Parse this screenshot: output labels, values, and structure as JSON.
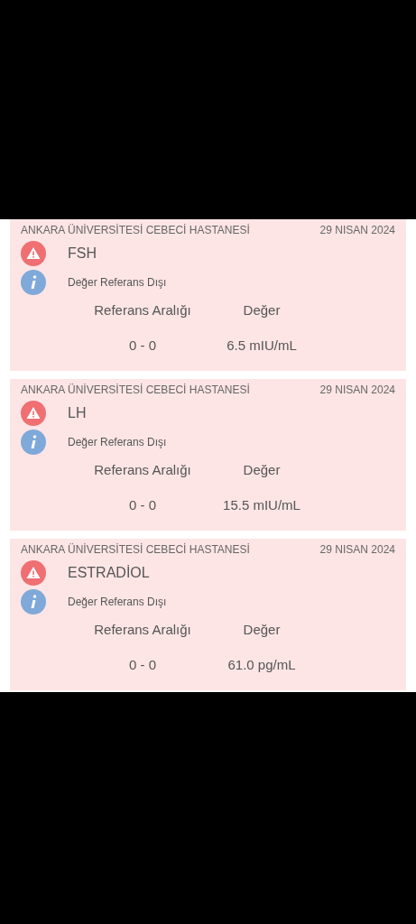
{
  "results": [
    {
      "hospital": "ANKARA ÜNİVERSİTESİ CEBECİ HASTANESİ",
      "date": "29 NISAN 2024",
      "test": "FSH",
      "status": "Değer Referans Dışı",
      "range_label": "Referans Aralığı",
      "value_label": "Değer",
      "range": "0 - 0",
      "value": "6.5 mIU/mL"
    },
    {
      "hospital": "ANKARA ÜNİVERSİTESİ CEBECİ HASTANESİ",
      "date": "29 NISAN 2024",
      "test": "LH",
      "status": "Değer Referans Dışı",
      "range_label": "Referans Aralığı",
      "value_label": "Değer",
      "range": "0 - 0",
      "value": "15.5 mIU/mL"
    },
    {
      "hospital": "ANKARA ÜNİVERSİTESİ CEBECİ HASTANESİ",
      "date": "29 NISAN 2024",
      "test": "ESTRADİOL",
      "status": "Değer Referans Dışı",
      "range_label": "Referans Aralığı",
      "value_label": "Değer",
      "range": "0 - 0",
      "value": "61.0 pg/mL"
    }
  ]
}
